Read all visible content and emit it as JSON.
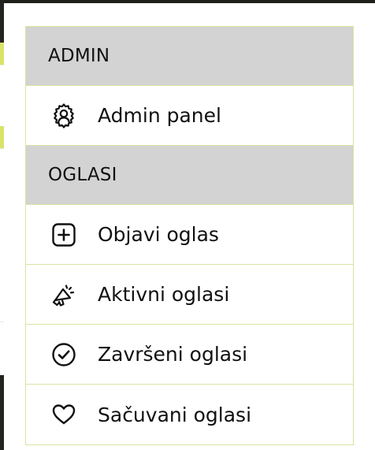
{
  "menu": {
    "sections": [
      {
        "title": "ADMIN",
        "items": [
          {
            "label": "Admin panel",
            "icon": "admin-gear-user-icon"
          }
        ]
      },
      {
        "title": "OGLASI",
        "items": [
          {
            "label": "Objavi oglas",
            "icon": "plus-square-icon"
          },
          {
            "label": "Aktivni oglasi",
            "icon": "megaphone-icon"
          },
          {
            "label": "Završeni oglasi",
            "icon": "check-circle-icon"
          },
          {
            "label": "Sačuvani oglasi",
            "icon": "heart-icon"
          }
        ]
      }
    ]
  },
  "colors": {
    "section_header_bg": "#d3d3d3",
    "border": "#d9e4a1",
    "text": "#111111",
    "accent": "#d9e36a",
    "dark": "#1f1f1c"
  }
}
